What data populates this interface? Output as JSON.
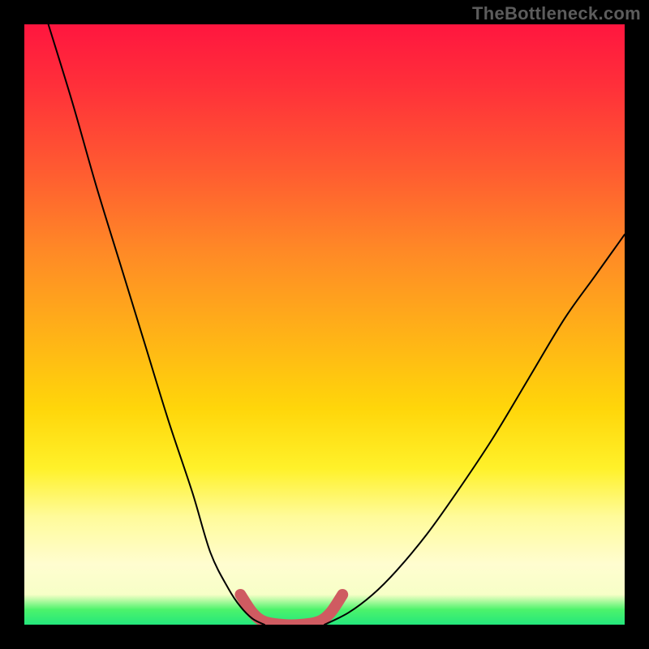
{
  "watermark": "TheBottleneck.com",
  "chart_data": {
    "type": "line",
    "title": "",
    "xlabel": "",
    "ylabel": "",
    "x_range": [
      0,
      100
    ],
    "y_range": [
      0,
      100
    ],
    "grid": false,
    "legend": false,
    "series": [
      {
        "name": "left-curve",
        "x": [
          4,
          8,
          12,
          16,
          20,
          24,
          28,
          31,
          34,
          36,
          38,
          40
        ],
        "y": [
          100,
          87,
          73,
          60,
          47,
          34,
          22,
          12,
          6,
          3,
          1,
          0
        ],
        "stroke": "#000000",
        "width": 2
      },
      {
        "name": "right-curve",
        "x": [
          50,
          54,
          58,
          62,
          67,
          72,
          78,
          84,
          90,
          95,
          100
        ],
        "y": [
          0,
          2,
          5,
          9,
          15,
          22,
          31,
          41,
          51,
          58,
          65
        ],
        "stroke": "#000000",
        "width": 2
      },
      {
        "name": "bottom-highlight",
        "x": [
          36,
          38,
          40,
          43,
          46,
          49,
          51,
          53
        ],
        "y": [
          5,
          2,
          0.5,
          0,
          0,
          0.5,
          2,
          5
        ],
        "stroke": "#cf5b61",
        "width": 14
      }
    ],
    "gradient_bands": [
      {
        "pos": 0.0,
        "color": "#ff163f",
        "label": "red"
      },
      {
        "pos": 0.4,
        "color": "#ff8a26",
        "label": "orange"
      },
      {
        "pos": 0.7,
        "color": "#fff12a",
        "label": "yellow"
      },
      {
        "pos": 0.9,
        "color": "#fffdd0",
        "label": "cream"
      },
      {
        "pos": 0.98,
        "color": "#24e77c",
        "label": "green"
      }
    ]
  }
}
